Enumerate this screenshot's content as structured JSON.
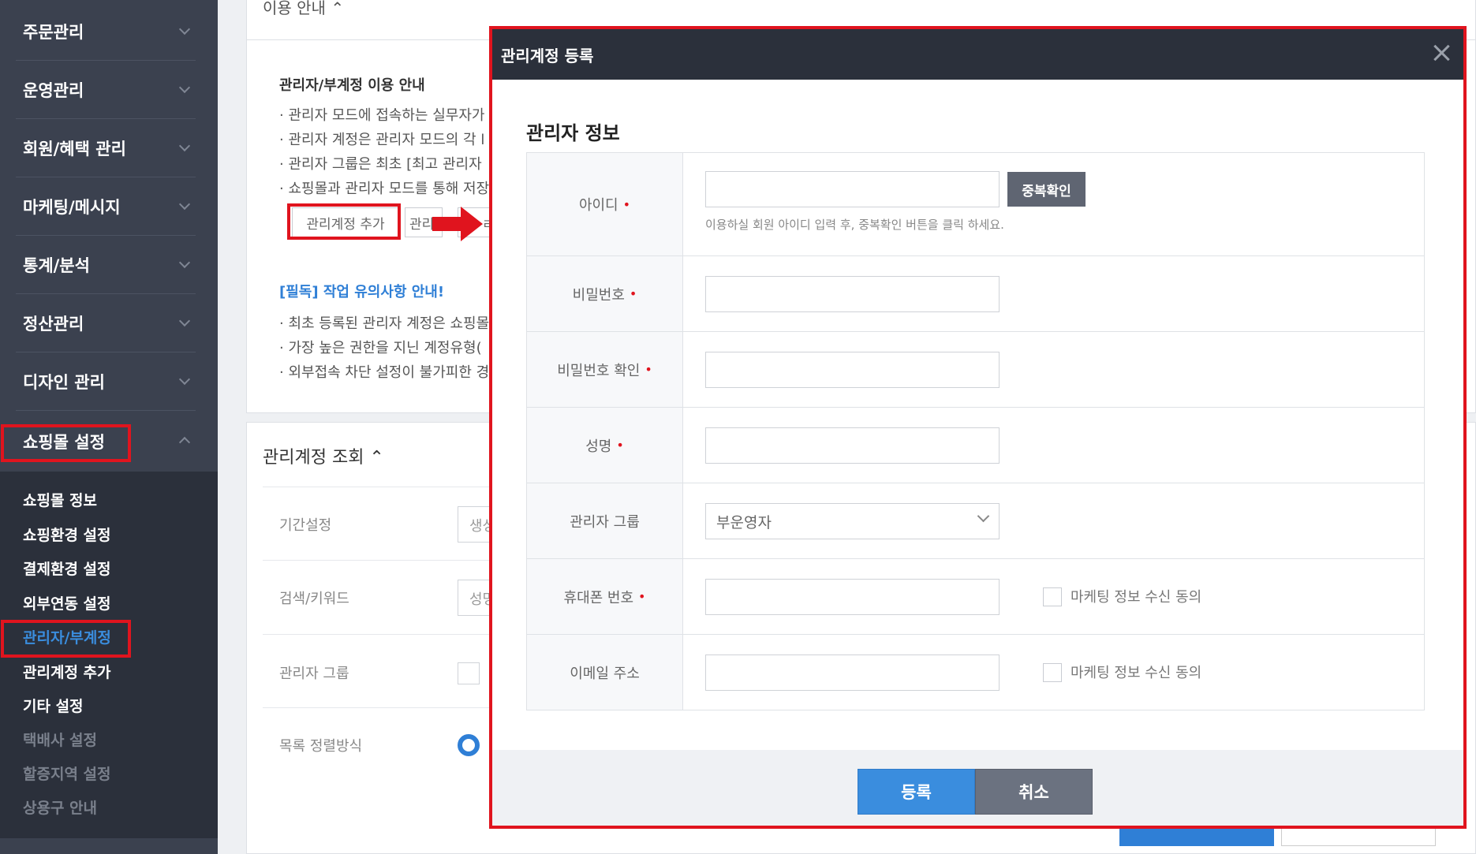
{
  "sidebar": {
    "items": [
      {
        "label": "주문관리"
      },
      {
        "label": "운영관리"
      },
      {
        "label": "회원/혜택 관리"
      },
      {
        "label": "마케팅/메시지"
      },
      {
        "label": "통계/분석"
      },
      {
        "label": "정산관리"
      },
      {
        "label": "디자인 관리"
      },
      {
        "label": "쇼핑몰 설정"
      }
    ],
    "sub_items": [
      {
        "label": "쇼핑몰 정보"
      },
      {
        "label": "쇼핑환경 설정"
      },
      {
        "label": "결제환경 설정"
      },
      {
        "label": "외부연동 설정"
      },
      {
        "label": "관리자/부계정"
      },
      {
        "label": "관리계정 추가"
      },
      {
        "label": "기타 설정"
      },
      {
        "label": "택배사 설정"
      },
      {
        "label": "할증지역 설정"
      },
      {
        "label": "상용구 안내"
      }
    ]
  },
  "guide": {
    "tab_label": "이용 안내 ⌃",
    "title": "관리자/부계정 이용 안내",
    "bullets": [
      "· 관리자 모드에 접속하는 실무자가",
      "· 관리자 계정은 관리자 모드의 각 l",
      "· 관리자 그룹은 최초 [최고 관리자",
      "· 쇼핑몰과 관리자 모드를 통해 저장"
    ],
    "add_account_btn": "관리계정 추가",
    "second_btn": "관리",
    "third_btn": "ㄹ",
    "notice_title": "[필독] 작업 유의사항 안내!",
    "notice_bullets": [
      "· 최초 등록된 관리자 계정은 쇼핑몰",
      "· 가장 높은 권한을 지닌 계정유형(",
      "· 외부접속 차단 설정이 불가피한 경"
    ]
  },
  "search": {
    "title": "관리계정 조회 ⌃",
    "rows": [
      {
        "label": "기간설정",
        "value": "생성"
      },
      {
        "label": "검색/키워드",
        "value": "성명"
      },
      {
        "label": "관리자 그룹"
      },
      {
        "label": "목록 정렬방식"
      }
    ]
  },
  "modal": {
    "title": "관리계정 등록",
    "section_title": "관리자 정보",
    "fields": {
      "id": {
        "label": "아이디",
        "value": "",
        "dup_btn": "중복확인",
        "help": "이용하실 회원 아이디 입력 후, 중복확인 버튼을 클릭 하세요."
      },
      "password": {
        "label": "비밀번호",
        "value": ""
      },
      "password_confirm": {
        "label": "비밀번호 확인",
        "value": ""
      },
      "name": {
        "label": "성명",
        "value": ""
      },
      "group": {
        "label": "관리자 그룹",
        "selected": "부운영자"
      },
      "phone": {
        "label": "휴대폰 번호",
        "value": "",
        "consent_label": "마케팅 정보 수신 동의",
        "consent_checked": false
      },
      "email": {
        "label": "이메일 주소",
        "value": "",
        "consent_label": "마케팅 정보 수신 동의",
        "consent_checked": false
      }
    },
    "required_mark": "•",
    "submit_label": "등록",
    "cancel_label": "취소"
  },
  "colors": {
    "sidebar_bg": "#3b414f",
    "submenu_bg": "#2b303b",
    "accent_blue": "#3a8dde",
    "highlight_red": "#e0141e",
    "modal_header": "#2b303b"
  },
  "icons": {
    "sidebar_chevron": "chevron-down-icon",
    "close": "close-icon",
    "annotation_arrow": "right-arrow-icon"
  }
}
